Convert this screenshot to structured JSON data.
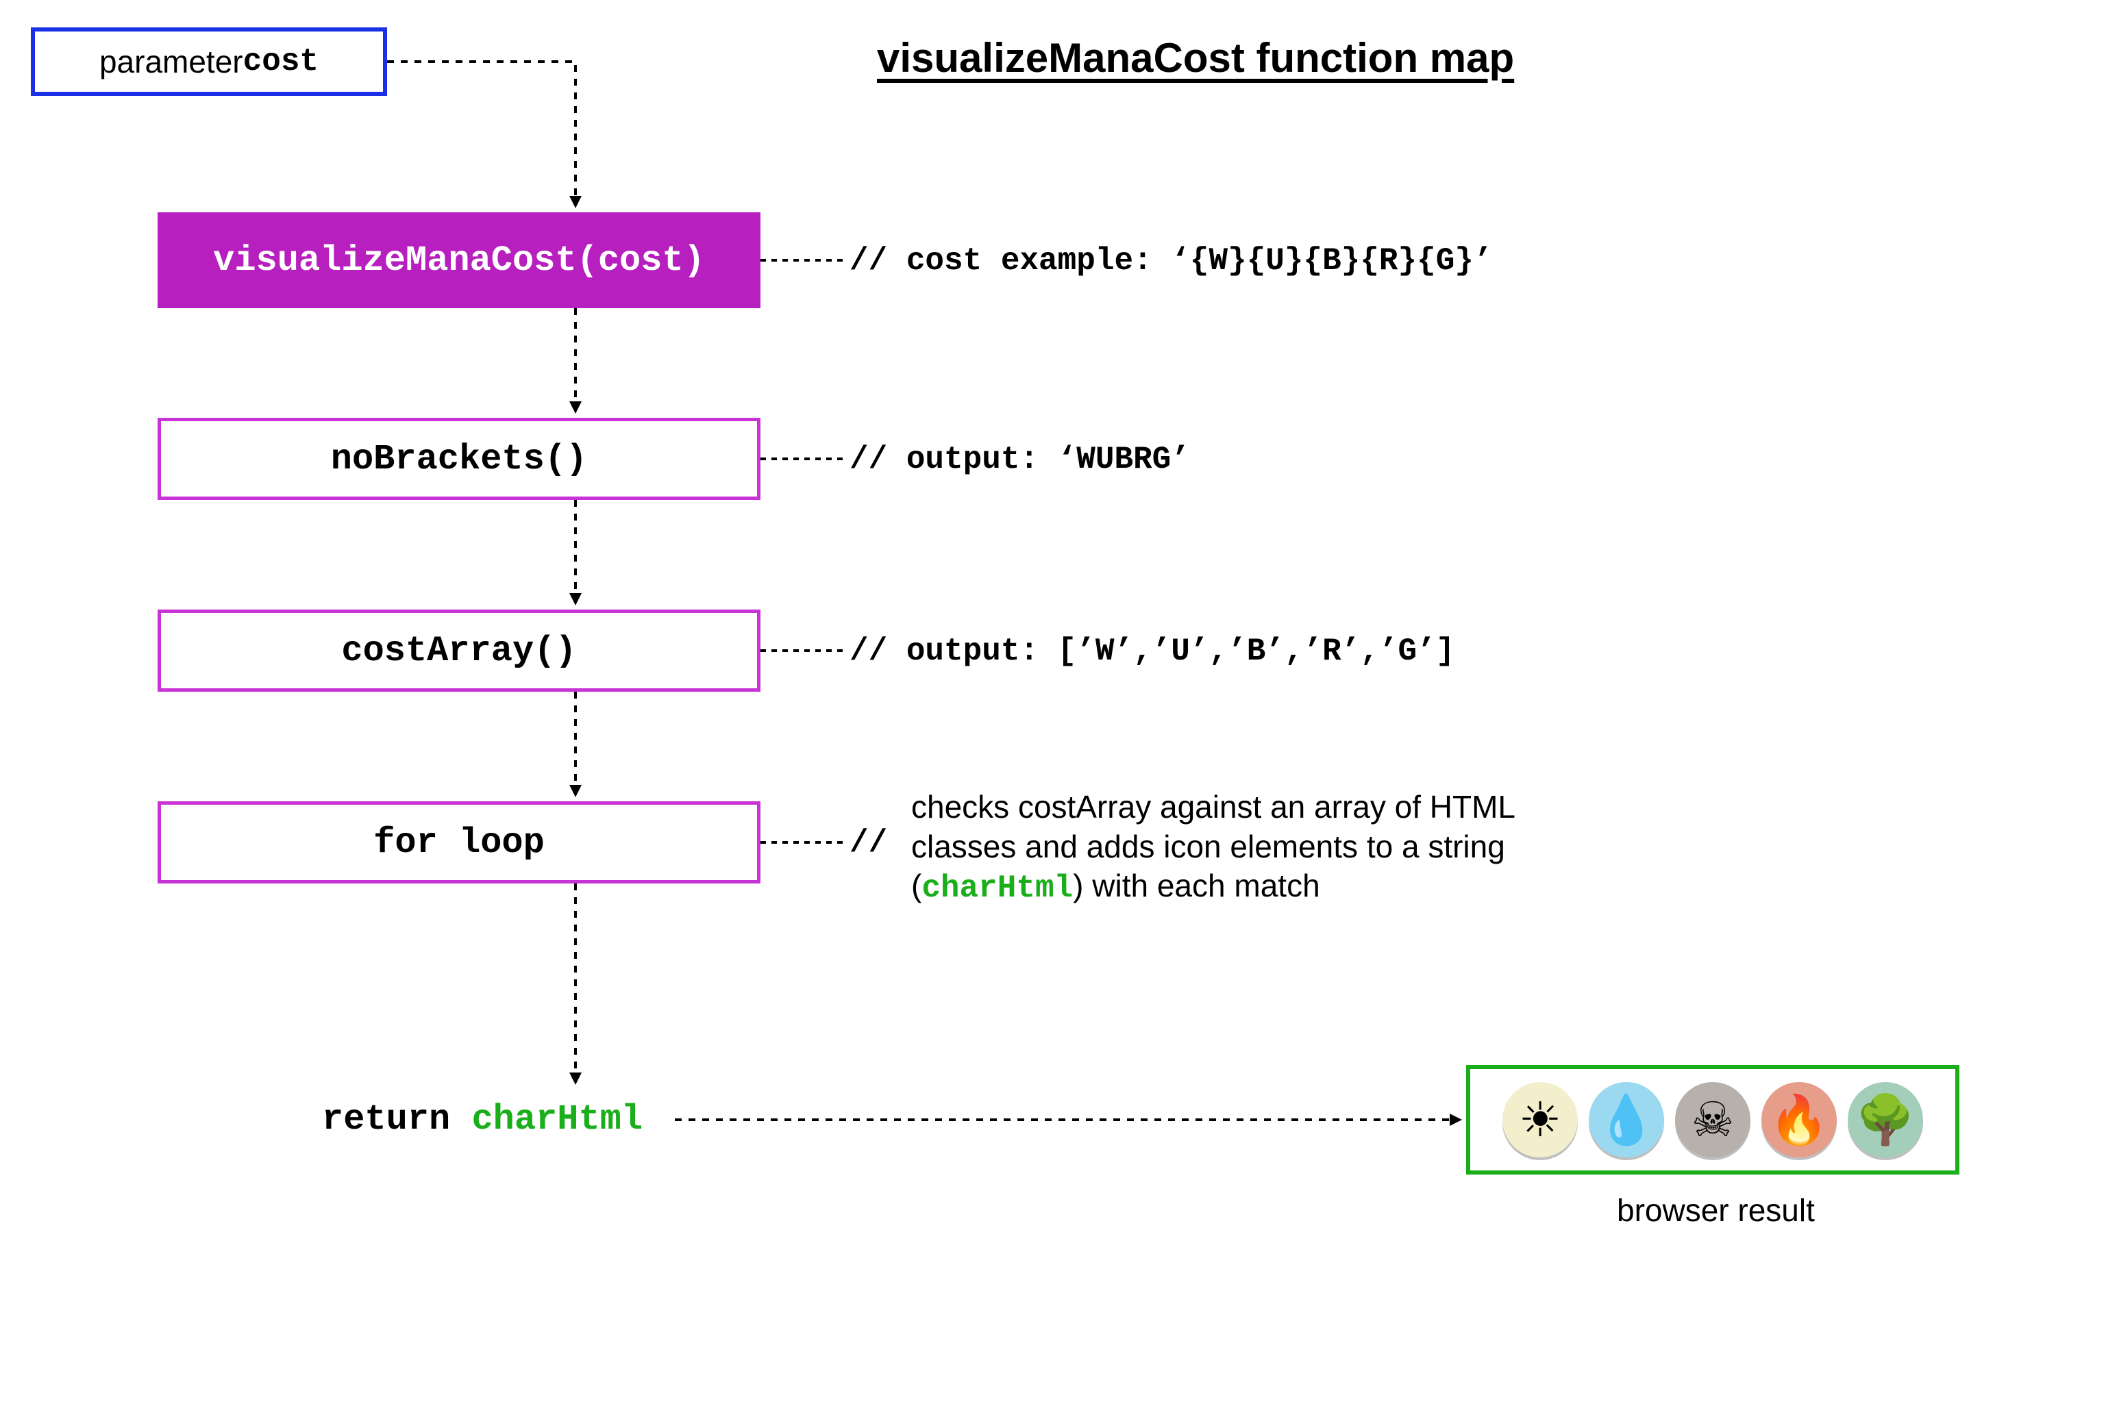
{
  "title": "visualizeManaCost function map",
  "colors": {
    "blue_border": "#1a2fe6",
    "magenta_fill": "#b81fbf",
    "magenta_border": "#c733d4",
    "green": "#1aae1a"
  },
  "nodes": {
    "param": {
      "label_pre": "parameter ",
      "label_code": "cost"
    },
    "call": {
      "label": "visualizeManaCost(cost)"
    },
    "noBrackets": {
      "label": "noBrackets()"
    },
    "costArray": {
      "label": "costArray()"
    },
    "forLoop": {
      "label": "for loop"
    }
  },
  "comments": {
    "call": "// cost example: ‘{W}{U}{B}{R}{G}’",
    "noBrackets": "// output: ‘WUBRG’",
    "costArray": "// output: [’W’,’U’,’B’,’R’,’G’]",
    "forLoop_slashes": "//",
    "forLoop_desc_1": "checks costArray against an array of HTML",
    "forLoop_desc_2": "classes and adds icon elements to a string",
    "forLoop_desc_3a": "(",
    "forLoop_desc_code": "charHtml",
    "forLoop_desc_3b": ") with each match"
  },
  "return_line": {
    "pre": "return ",
    "code": "charHtml"
  },
  "browser_result_caption": "browser result",
  "mana_icons": [
    {
      "name": "white",
      "bg": "#f3eecb",
      "glyph": "☀︎"
    },
    {
      "name": "blue",
      "bg": "#9ad9f0",
      "glyph": "💧"
    },
    {
      "name": "black",
      "bg": "#b7b0ab",
      "glyph": "☠︎"
    },
    {
      "name": "red",
      "bg": "#e69e8a",
      "glyph": "🔥"
    },
    {
      "name": "green",
      "bg": "#a3cfba",
      "glyph": "🌳"
    }
  ]
}
